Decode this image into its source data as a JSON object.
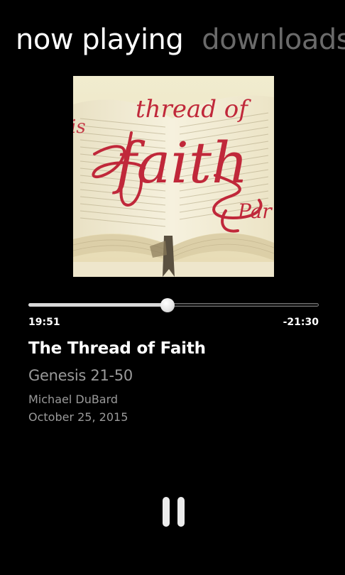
{
  "pivot": {
    "tabs": [
      {
        "label": "now playing",
        "active": true
      },
      {
        "label": "downloads",
        "active": false
      }
    ]
  },
  "album_art": {
    "text_top": "thread of",
    "text_main": "faith",
    "text_side": "is",
    "text_right": "Par"
  },
  "player": {
    "progress_fraction": 0.48,
    "elapsed": "19:51",
    "remaining": "-21:30",
    "control_icon": "pause-icon"
  },
  "track": {
    "title": "The Thread of Faith",
    "series": "Genesis 21-50",
    "speaker": "Michael DuBard",
    "date": "October 25, 2015"
  },
  "colors": {
    "background": "#000000",
    "active_tab": "#ffffff",
    "inactive_tab": "#6a6a6a",
    "secondary_text": "#9a9a9a",
    "album_ink": "#c0283a"
  }
}
